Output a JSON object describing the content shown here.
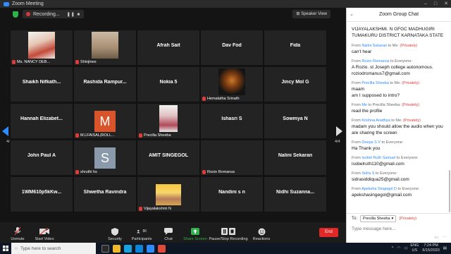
{
  "window": {
    "title": "Zoom Meeting",
    "controls": [
      "–",
      "□",
      "✕"
    ]
  },
  "meeting": {
    "recording_label": "Recording...",
    "recording_controls": "❚❚  ■",
    "speaker_view_label": "Speaker View",
    "page_left": "4/4",
    "page_right": "4/4"
  },
  "tiles": [
    {
      "name": "",
      "label": "Ms. NANCY DEB...",
      "pic": "nancy",
      "muted": true
    },
    {
      "name": "",
      "label": "Shinjinee",
      "pic": "shinjinee",
      "muted": true
    },
    {
      "name": "Afrah Sait",
      "label": "",
      "muted": false
    },
    {
      "name": "Dav Fod",
      "label": "",
      "muted": false
    },
    {
      "name": "Fida",
      "label": "",
      "muted": false
    },
    {
      "name": "Shaikh  Nifkath...",
      "label": "",
      "muted": false
    },
    {
      "name": "Rashida  Rampur...",
      "label": "",
      "muted": false
    },
    {
      "name": "Nokia 5",
      "label": "",
      "muted": false
    },
    {
      "name": "",
      "label": "Hemalatha Srinath",
      "pic": "hema",
      "muted": true
    },
    {
      "name": "Jincy Mol G",
      "label": "",
      "muted": false
    },
    {
      "name": "Hannah  Elizabet...",
      "label": "",
      "muted": false
    },
    {
      "name": "",
      "label": "M.LFAISAL(ROLL...",
      "letter": "M",
      "letterClass": "m",
      "muted": true
    },
    {
      "name": "",
      "label": "Precilla Sheeba",
      "pic": "precilla",
      "muted": true
    },
    {
      "name": "Ishasri S",
      "label": "",
      "muted": false
    },
    {
      "name": "Sowmya N",
      "label": "",
      "muted": false
    },
    {
      "name": "John Paul A",
      "label": "",
      "muted": false
    },
    {
      "name": "",
      "label": "shruthi hs",
      "letter": "S",
      "letterClass": "s",
      "muted": true
    },
    {
      "name": "AMIT SINGEGOL",
      "label": "",
      "muted": false
    },
    {
      "name": "",
      "label": "Rozio Romanus",
      "muted": true
    },
    {
      "name": "Nalini Sekaran",
      "label": "",
      "muted": false
    },
    {
      "name": "1WM610p5kKw...",
      "label": "",
      "muted": false
    },
    {
      "name": "Shwetha Ravindra",
      "label": "",
      "muted": false
    },
    {
      "name": "",
      "label": "Vijayalakshmi N",
      "pic": "vijaya",
      "muted": true
    },
    {
      "name": "Nandini s n",
      "label": "",
      "muted": false
    },
    {
      "name": "Nidhi  Suzanna...",
      "label": "",
      "muted": false
    }
  ],
  "toolbar": {
    "unmute": "Unmute",
    "start_video": "Start Video",
    "security": "Security",
    "participants": "Participants",
    "participants_count": "86",
    "chat": "Chat",
    "share_screen": "Share Screen",
    "pause_recording": "Pause/Stop Recording",
    "reactions": "Reactions",
    "end": "End"
  },
  "chat": {
    "title": "Zoom Group Chat",
    "top_text": "VIJAYALAKSHMI. N GFGC MADHUGIRI TUMAKURU DISTRICT KARNATAKA STATE",
    "messages": [
      {
        "from": "From",
        "who": "Nalini Sekaran",
        "to": "to Me:",
        "priv": "(Privately)",
        "text": "can't hear"
      },
      {
        "from": "From",
        "who": "Rozio Romanus",
        "to": "to Everyone:",
        "priv": "",
        "text": "A Rozio. st Joseph college autonomous. roziodromanus7@gmail.com"
      },
      {
        "from": "From",
        "who": "Precilla Sheeba",
        "to": "to Me:",
        "priv": "(Privately)",
        "text": "maam\nam I supposed to intro?"
      },
      {
        "from": "From",
        "who": "Me",
        "to": "to Precilla Sheeba:",
        "priv": "(Privately)",
        "text": "read the profile"
      },
      {
        "from": "From",
        "who": "Krishna Aradhya",
        "to": "to Me:",
        "priv": "(Privately)",
        "text": "madam you should allow the audio when you are sharing the screen"
      },
      {
        "from": "From",
        "who": "Deepa S V",
        "to": "to Everyone:",
        "priv": "",
        "text": "Ha Thank you"
      },
      {
        "from": "From",
        "who": "Isobel Ruth Samuel",
        "to": "to Everyone:",
        "priv": "",
        "text": "isobelruth110@gmail.com"
      },
      {
        "from": "From",
        "who": "Sidra S",
        "to": "to Everyone:",
        "priv": "",
        "text": "sidrasiddiqua25@gmail.com"
      },
      {
        "from": "From",
        "who": "Apeksha Singegol D",
        "to": "to Everyone:",
        "priv": "",
        "text": "apekshasingegol@gmail.com"
      }
    ],
    "to_label": "To:",
    "to_value": "Precilla Sheeba",
    "to_privacy": "(Privately)",
    "input_placeholder": "Type message here...",
    "footer_icons": [
      "file-icon",
      "more-icon"
    ]
  },
  "taskbar": {
    "search_placeholder": "Type here to search",
    "lang_line1": "ENG",
    "lang_line2": "US",
    "time": "7:24 PM",
    "date": "6/15/2020"
  }
}
